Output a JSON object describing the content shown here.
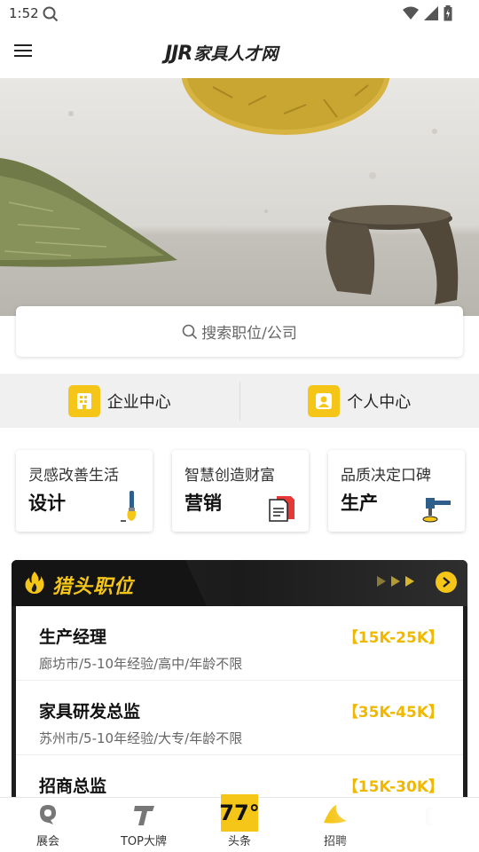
{
  "status_bar": {
    "time": "1:52"
  },
  "app_bar": {
    "logo_latin": "JJR",
    "logo_cn": "家具人才网"
  },
  "search": {
    "placeholder": "搜索职位/公司"
  },
  "centers": [
    {
      "label": "企业中心",
      "icon": "company-icon"
    },
    {
      "label": "个人中心",
      "icon": "person-icon"
    }
  ],
  "categories": [
    {
      "subtitle": "灵感改善生活",
      "title": "设计",
      "icon": "paintbrush-icon"
    },
    {
      "subtitle": "智慧创造财富",
      "title": "营销",
      "icon": "document-icon"
    },
    {
      "subtitle": "品质决定口碑",
      "title": "生产",
      "icon": "hammer-icon"
    }
  ],
  "headhunter": {
    "title": "猎头职位",
    "jobs": [
      {
        "title": "生产经理",
        "salary": "【15K-25K】",
        "meta": "廊坊市/5-10年经验/高中/年龄不限"
      },
      {
        "title": "家具研发总监",
        "salary": "【35K-45K】",
        "meta": "苏州市/5-10年经验/大专/年龄不限"
      },
      {
        "title": "招商总监",
        "salary": "【15K-30K】",
        "meta": ""
      }
    ]
  },
  "bottom_nav": [
    {
      "label": "展会",
      "icon": "expo-icon"
    },
    {
      "label": "TOP大牌",
      "icon": "top-brand-icon"
    },
    {
      "label": "头条",
      "icon": "headline-77-icon",
      "badge": "77°"
    },
    {
      "label": "招聘",
      "icon": "recruit-icon"
    },
    {
      "label": "",
      "icon": "profile-icon"
    }
  ],
  "colors": {
    "accent": "#f5c518",
    "salary": "#f0b800",
    "dark": "#1e1e1e"
  }
}
